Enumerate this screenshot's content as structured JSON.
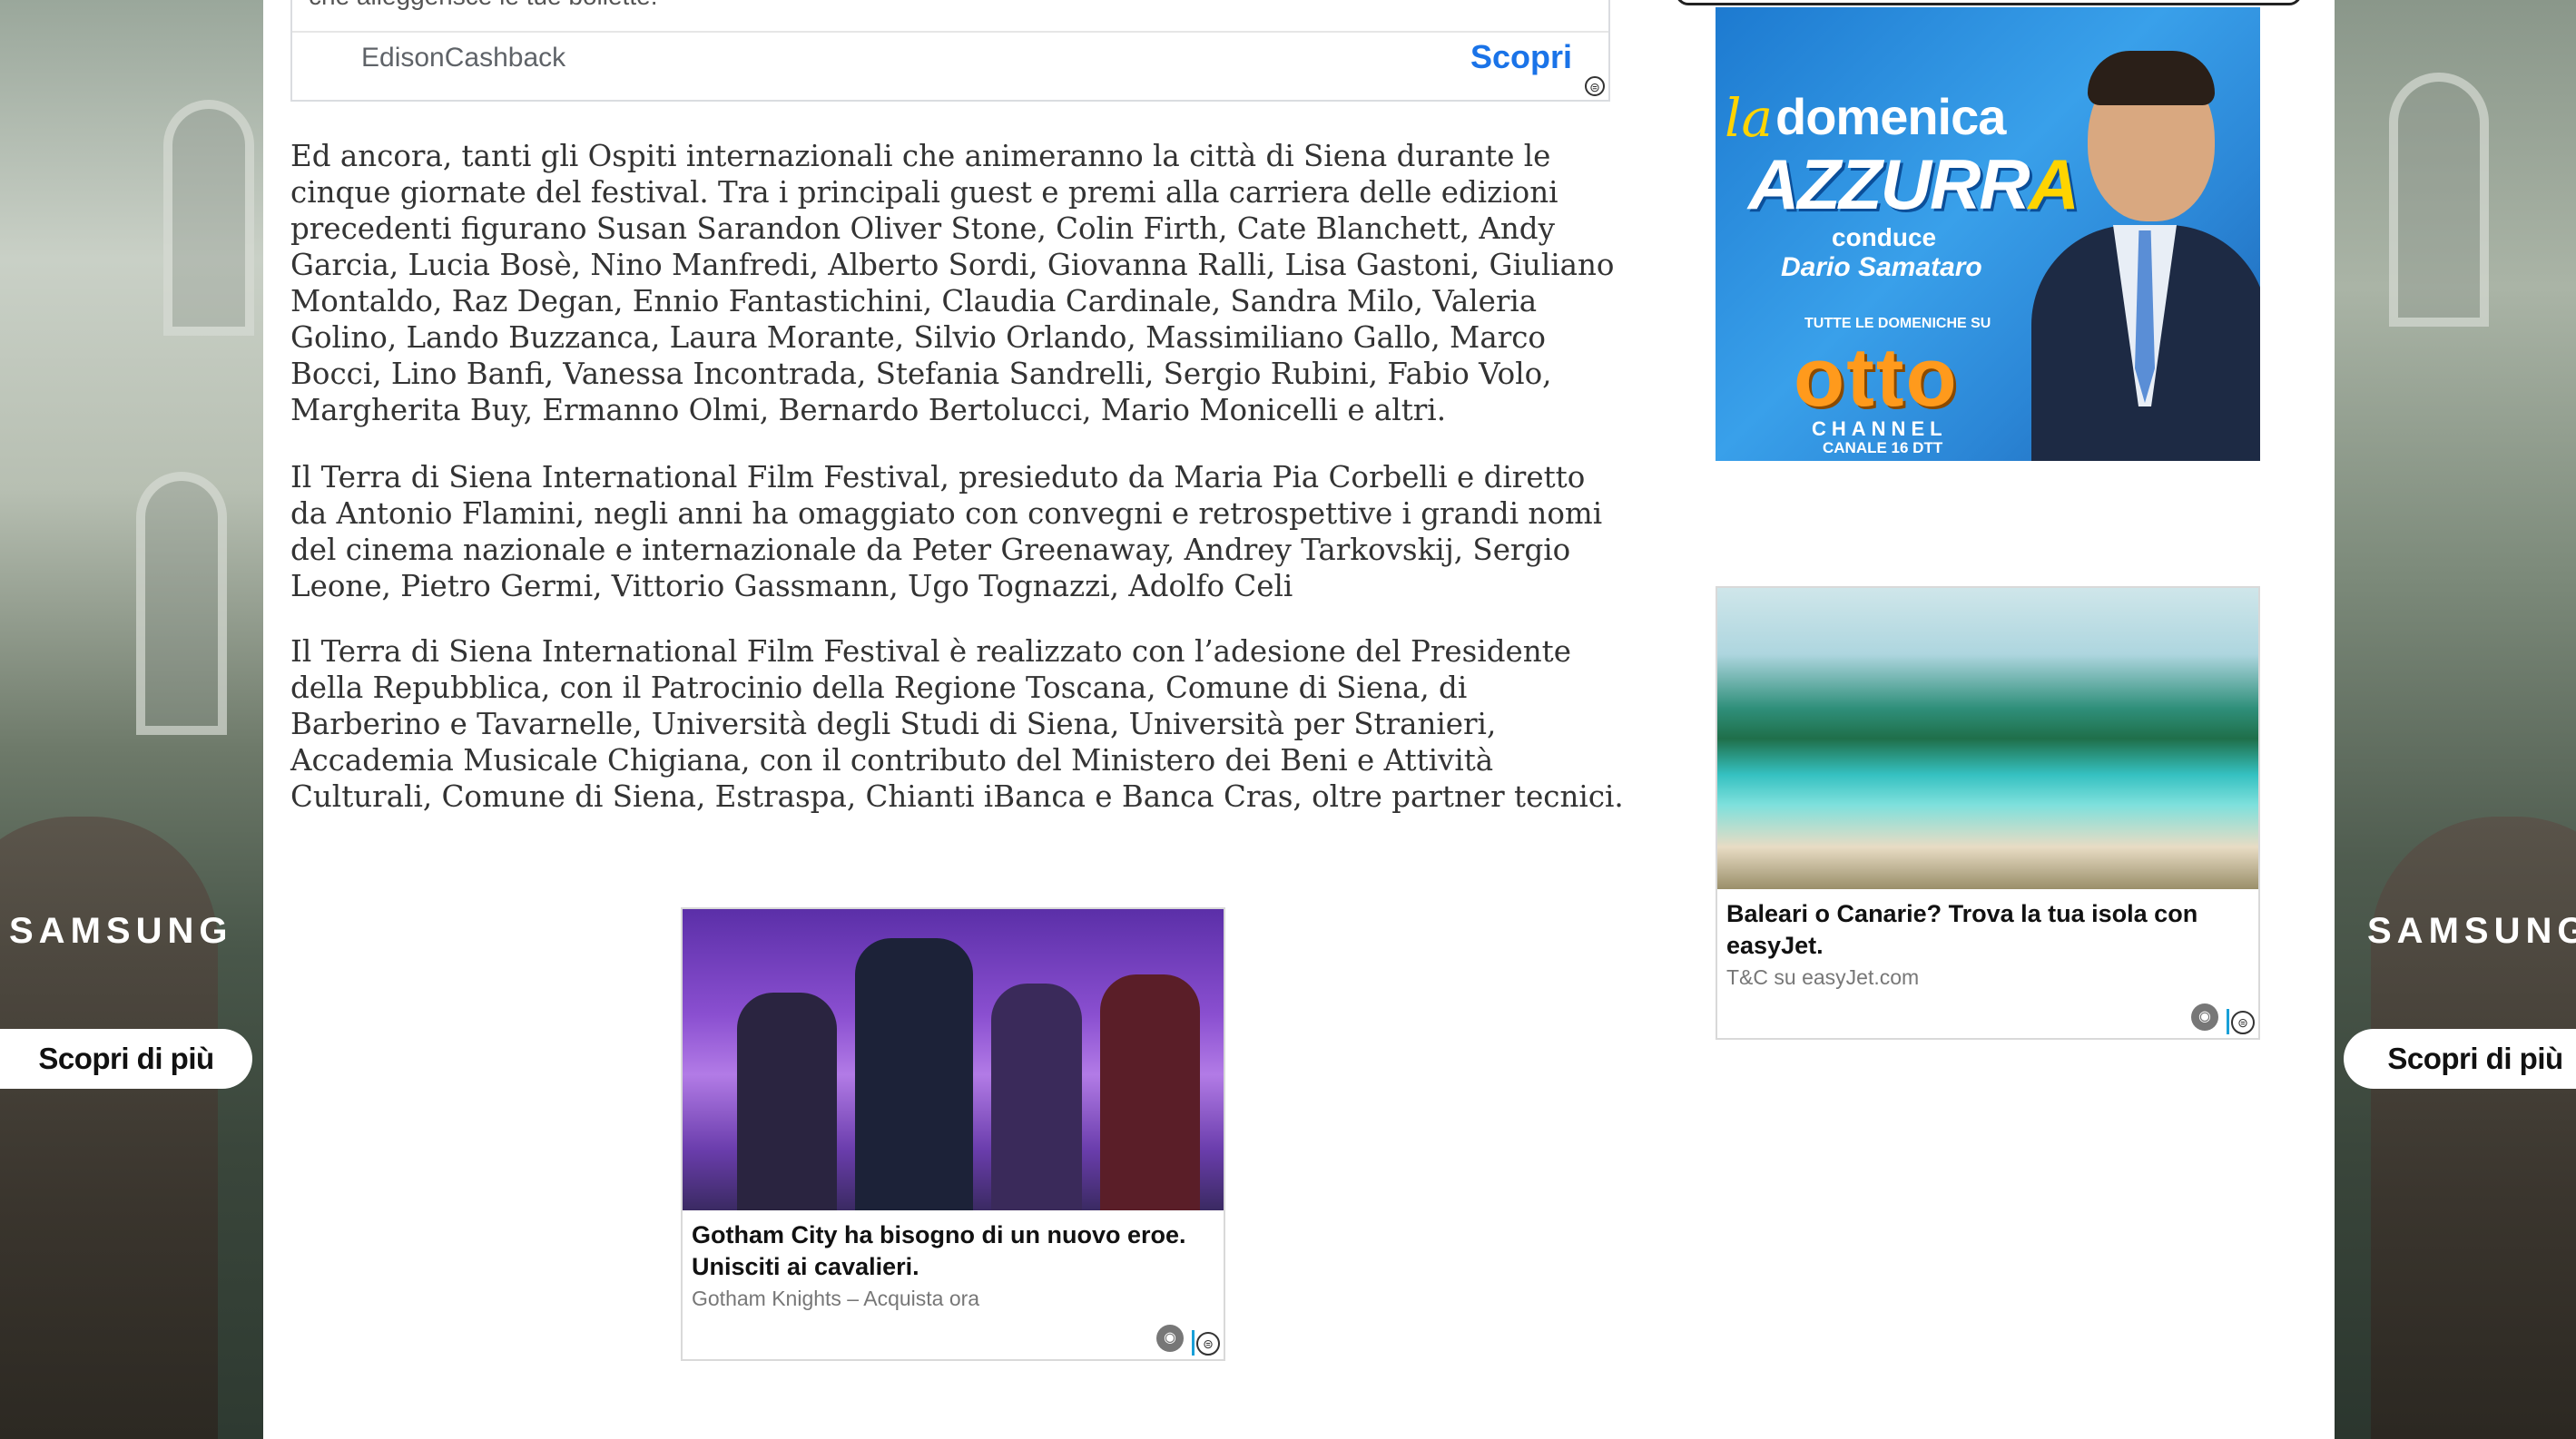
{
  "skins": {
    "left": {
      "brand": "SAMSUNG",
      "cta": "Scopri di più"
    },
    "right": {
      "brand": "SAMSUNG",
      "cta": "Scopri di più"
    }
  },
  "top_ad": {
    "text_partial": "che alleggerisce le tue bollette.",
    "advertiser": "EdisonCashback",
    "cta": "Scopri",
    "adchoice": "⊜"
  },
  "article": {
    "p1": "Ed ancora, tanti gli Ospiti internazionali che animeranno la città di Siena durante le cinque giornate del festival. Tra i principali guest e premi alla carriera delle edizioni precedenti figurano Susan Sarandon Oliver Stone, Colin Firth, Cate Blanchett, Andy Garcia, Lucia Bosè, Nino Manfredi, Alberto Sordi, Giovanna Ralli, Lisa Gastoni, Giuliano Montaldo, Raz Degan, Ennio Fantastichini, Claudia Cardinale, Sandra Milo, Valeria Golino, Lando Buzzanca, Laura Morante, Silvio Orlando, Massimiliano Gallo, Marco Bocci, Lino Banfi, Vanessa Incontrada, Stefania Sandrelli, Sergio Rubini, Fabio Volo,  Margherita Buy, Ermanno Olmi, Bernardo Bertolucci, Mario Monicelli e altri.",
    "p2": "Il Terra di Siena International Film Festival, presieduto da Maria Pia Corbelli e diretto da Antonio Flamini, negli anni ha omaggiato con convegni e retrospettive i grandi nomi del cinema nazionale e internazionale da Peter Greenaway, Andrey Tarkovskij, Sergio Leone, Pietro Germi, Vittorio Gassmann, Ugo Tognazzi, Adolfo Celi",
    "p3": " Il Terra di Siena International Film Festival è realizzato con l’adesione del Presidente della Repubblica, con il Patrocinio della Regione Toscana, Comune di Siena, di Barberino e Tavarnelle, Università degli Studi di Siena, Università per Stranieri, Accademia Musicale Chigiana, con il contributo del Ministero dei Beni e Attività Culturali, Comune di Siena, Estraspa, Chianti iBanca e Banca Cras, oltre partner tecnici."
  },
  "ad_gotham": {
    "headline": "Gotham City ha bisogno di un nuovo eroe. Unisciti ai cavalieri.",
    "source": "Gotham Knights – Acquista ora",
    "privacy_icon": "privacy-icon",
    "adchoice": "⊜"
  },
  "ad_easyjet": {
    "headline": "Baleari o Canarie? Trova la tua isola con easyJet.",
    "source": "T&C su easyJet.com",
    "privacy_icon": "privacy-icon",
    "adchoice": "⊜"
  },
  "banner_azzurra": {
    "la": "la",
    "domenica": "domenica",
    "azzurra_main": "AZZURR",
    "azzurra_last": "A",
    "conduce": "conduce",
    "host": "Dario Samataro",
    "tutte": "TUTTE LE DOMENICHE SU",
    "otto": "otto",
    "channel": "CHANNEL",
    "canale": "CANALE 16 DTT"
  },
  "colors": {
    "link_blue": "#1a73e8",
    "text": "#333333",
    "banner_blue": "#2b86d6",
    "otto_orange": "#ff9a1c"
  }
}
